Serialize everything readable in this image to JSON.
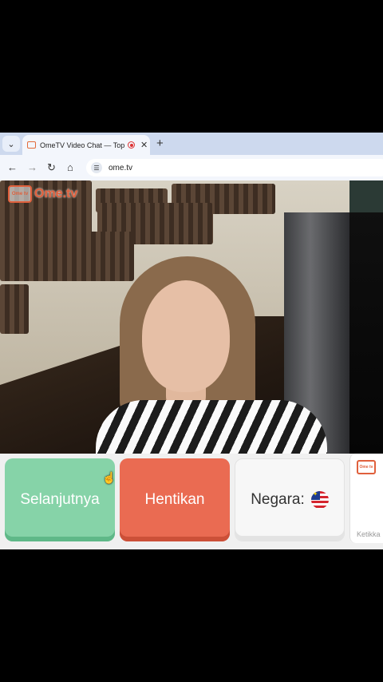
{
  "browser": {
    "tab": {
      "title": "OmeTV Video Chat — Top"
    },
    "address_bar": {
      "url": "ome.tv"
    },
    "icons": {
      "tab_list": "chevron-down-icon",
      "new_tab": "plus-icon",
      "back": "arrow-left-icon",
      "forward": "arrow-right-icon",
      "reload": "reload-icon",
      "home": "home-icon",
      "site_info": "tune-icon"
    }
  },
  "page": {
    "logo_tv": "Ome tv",
    "logo_text": "Ome.tv",
    "buttons": {
      "next": "Selanjutnya",
      "stop": "Hentikan",
      "country": "Negara:"
    },
    "chat": {
      "icon_text": "Ome tv",
      "input_placeholder": "Ketikka"
    },
    "colors": {
      "next": "#86d3a8",
      "stop": "#ea6b52",
      "brand": "#e0603c"
    }
  }
}
